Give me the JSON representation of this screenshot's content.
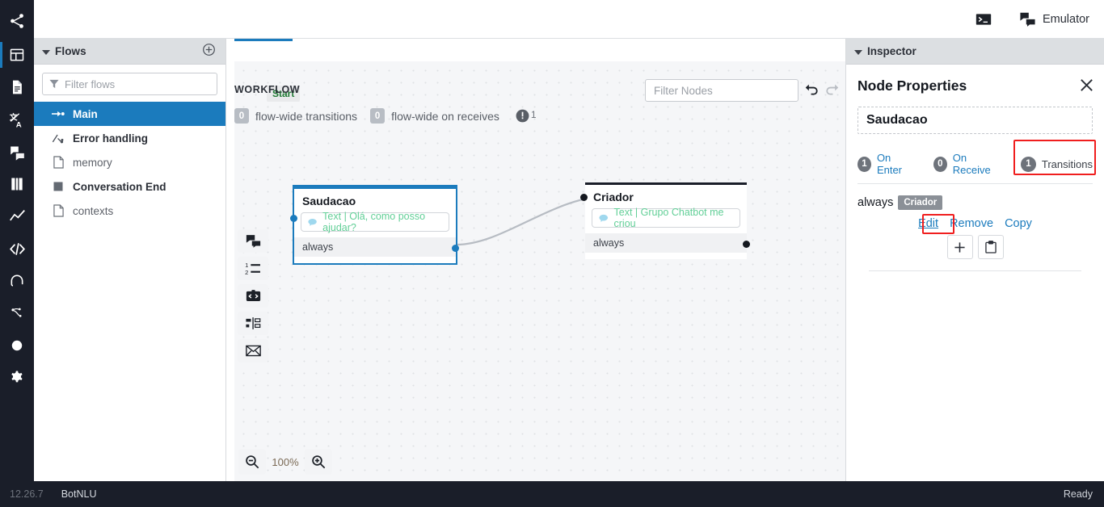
{
  "rail": {
    "items": [
      {
        "name": "share-nodes-icon",
        "label": "Share"
      },
      {
        "name": "dashboard-icon",
        "label": "Flow Editor",
        "active": true
      },
      {
        "name": "document-icon",
        "label": "Content"
      },
      {
        "name": "translate-icon",
        "label": "Translations"
      },
      {
        "name": "chat-icon",
        "label": "Conversations"
      },
      {
        "name": "book-icon",
        "label": "Library"
      },
      {
        "name": "analytics-icon",
        "label": "Analytics"
      },
      {
        "name": "code-icon",
        "label": "Code Editor"
      },
      {
        "name": "headset-icon",
        "label": "HITL"
      },
      {
        "name": "nlu-icon",
        "label": "NLU"
      },
      {
        "name": "circle-icon",
        "label": "Status"
      },
      {
        "name": "gear-icon",
        "label": "Settings"
      }
    ]
  },
  "topbar": {
    "terminal_label": "",
    "emulator_label": "Emulator"
  },
  "sidebar": {
    "title": "Flows",
    "add_tooltip": "Create new flow",
    "filter_placeholder": "Filter flows",
    "filter_value": "",
    "items": [
      {
        "label": "Main",
        "icon": "flow-start-icon",
        "selected": true,
        "bold": true
      },
      {
        "label": "Error handling",
        "icon": "error-flow-icon",
        "selected": false,
        "bold": true
      },
      {
        "label": "memory",
        "icon": "file-icon",
        "selected": false,
        "bold": false
      },
      {
        "label": "Conversation End",
        "icon": "square-icon",
        "selected": false,
        "bold": true
      },
      {
        "label": "contexts",
        "icon": "file-icon",
        "selected": false,
        "bold": false
      }
    ]
  },
  "workflow": {
    "tab_label": "WORKFLOW",
    "counters": [
      {
        "count": "0",
        "label": "flow-wide transitions"
      },
      {
        "count": "0",
        "label": "flow-wide on receives"
      }
    ],
    "warning_count": "1",
    "filter_nodes_placeholder": "Filter Nodes",
    "filter_nodes_value": "",
    "undo_label": "Undo",
    "redo_label": "Redo",
    "zoom_level": "100%",
    "toolbox": [
      {
        "name": "say-something-tool",
        "label": "Say Something"
      },
      {
        "name": "listen-tool",
        "label": "Listen"
      },
      {
        "name": "execute-tool",
        "label": "Execute"
      },
      {
        "name": "split-tool",
        "label": "Split"
      },
      {
        "name": "send-email-tool",
        "label": "Send Email"
      }
    ],
    "start_badge": "Start",
    "nodes": [
      {
        "title": "Saudacao",
        "action": "Text | Olá, como posso ajudar?",
        "transition": "always",
        "selected": true
      },
      {
        "title": "Criador",
        "action": "Text | Grupo Chatbot me criou",
        "transition": "always",
        "selected": false
      }
    ]
  },
  "inspector": {
    "panel_title": "Inspector",
    "heading": "Node Properties",
    "node_name": "Saudacao",
    "close_label": "Close",
    "tabs": [
      {
        "count": "1",
        "label": "On Enter",
        "active": false,
        "highlighted": false
      },
      {
        "count": "0",
        "label": "On Receive",
        "active": false,
        "highlighted": false
      },
      {
        "count": "1",
        "label": "Transitions",
        "active": true,
        "highlighted": true
      }
    ],
    "transition": {
      "condition": "always",
      "target": "Criador",
      "actions": [
        "Edit",
        "Remove",
        "Copy"
      ],
      "add_label": "+",
      "paste_label": "Paste"
    }
  },
  "statusbar": {
    "version": "12.26.7",
    "module": "BotNLU",
    "state": "Ready"
  },
  "colors": {
    "accent": "#1b7bbd",
    "dark": "#1a1e29",
    "highlight": "#f01e1e",
    "node_text_green": "#62cf97",
    "start_green": "#1f7a34"
  }
}
